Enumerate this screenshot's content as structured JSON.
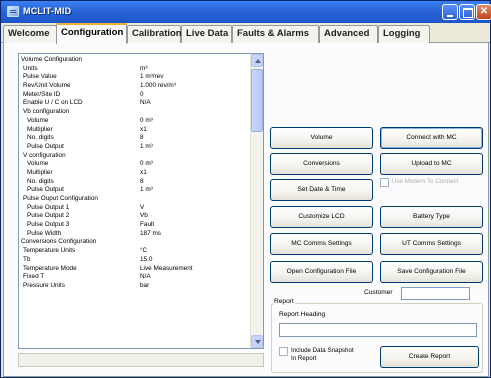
{
  "window": {
    "title": "MCLIT-MID"
  },
  "tabs": [
    {
      "label": "Welcome",
      "active": false
    },
    {
      "label": "Configuration",
      "active": true
    },
    {
      "label": "Calibration",
      "active": false
    },
    {
      "label": "Live Data",
      "active": false
    },
    {
      "label": "Faults & Alarms",
      "active": false
    },
    {
      "label": "Advanced",
      "active": false
    },
    {
      "label": "Logging",
      "active": false
    }
  ],
  "config": {
    "rows": [
      {
        "label": "Volume Configuration",
        "value": "",
        "level": 0
      },
      {
        "label": "Units",
        "value": "m³",
        "level": 1
      },
      {
        "label": "Pulse Value",
        "value": "1 m³/rev",
        "level": 1
      },
      {
        "label": "Rev/Unit Volume",
        "value": "1.000 rev/m³",
        "level": 1
      },
      {
        "label": "Meter/Site ID",
        "value": "0",
        "level": 1
      },
      {
        "label": "Enable U / C on LCD",
        "value": "N/A",
        "level": 1
      },
      {
        "label": "Vb configuration",
        "value": "",
        "level": 1
      },
      {
        "label": "Volume",
        "value": "0 m³",
        "level": 2
      },
      {
        "label": "Multiplier",
        "value": "x1",
        "level": 2
      },
      {
        "label": "No. digits",
        "value": "8",
        "level": 2
      },
      {
        "label": "Pulse Output",
        "value": "1 m³",
        "level": 2
      },
      {
        "label": "V configuration",
        "value": "",
        "level": 1
      },
      {
        "label": "Volume",
        "value": "0 m³",
        "level": 2
      },
      {
        "label": "Multiplier",
        "value": "x1",
        "level": 2
      },
      {
        "label": "No. digits",
        "value": "8",
        "level": 2
      },
      {
        "label": "Pulse Output",
        "value": "1 m³",
        "level": 2
      },
      {
        "label": "Pulse Ouput Configuration",
        "value": "",
        "level": 1
      },
      {
        "label": "Pulse Output 1",
        "value": "V",
        "level": 2
      },
      {
        "label": "Pulse Output 2",
        "value": "Vb",
        "level": 2
      },
      {
        "label": "Pulse Output 3",
        "value": "Fault",
        "level": 2
      },
      {
        "label": "Pulse Width",
        "value": "187 ms",
        "level": 2
      },
      {
        "label": "Conversions Configuration",
        "value": "",
        "level": 0
      },
      {
        "label": "Temperature Units",
        "value": "°C",
        "level": 1
      },
      {
        "label": "Tb",
        "value": "15.0",
        "level": 1
      },
      {
        "label": "Temperature Mode",
        "value": "Live Measurement",
        "level": 1
      },
      {
        "label": "Fixed T",
        "value": "N/A",
        "level": 1
      },
      {
        "label": "Pressure Units",
        "value": "bar",
        "level": 1
      }
    ]
  },
  "buttons": {
    "volume": "Volume",
    "connect": "Connect with MC",
    "conversions": "Conversions",
    "upload": "Upload to MC",
    "set_date_time": "Set Date & Time",
    "customize_lcd": "Customize LCD",
    "battery_type": "Battery Type",
    "mc_comms": "MC Comms Settings",
    "ut_comms": "UT Comms Settings",
    "open_config": "Open Configuration File",
    "save_config": "Save Configuration File",
    "create_report": "Create Report"
  },
  "use_modem": {
    "label": "Use Modem To Connect",
    "checked": false,
    "enabled": false
  },
  "customer": {
    "label": "Customer",
    "value": ""
  },
  "report": {
    "group_label": "Report",
    "heading_label": "Report Heading",
    "heading_value": "",
    "include_snapshot_label_1": "Include Data Snapshot",
    "include_snapshot_label_2": "In Report",
    "include_snapshot_checked": false
  },
  "icons": {
    "app": "app-window-icon",
    "minimize": "minimize-icon",
    "maximize": "maximize-icon",
    "close": "close-icon"
  }
}
